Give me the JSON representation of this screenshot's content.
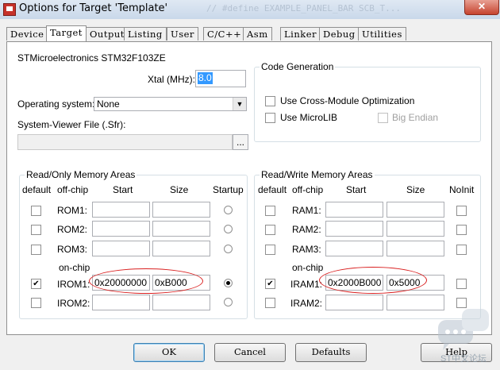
{
  "window": {
    "title": "Options for Target 'Template'",
    "close_label": "✕",
    "bg_text": "// #define EXAMPLE_PANEL_BAR  SCB_T..."
  },
  "tabs": [
    "Device",
    "Target",
    "Output",
    "Listing",
    "User",
    "C/C++",
    "Asm",
    "Linker",
    "Debug",
    "Utilities"
  ],
  "active_tab": "Target",
  "device": "STMicroelectronics STM32F103ZE",
  "xtal": {
    "label": "Xtal (MHz):",
    "value": "8.0"
  },
  "os": {
    "label": "Operating system:",
    "value": "None"
  },
  "svf": {
    "label": "System-Viewer File (.Sfr):",
    "value": "",
    "browse": "..."
  },
  "codegen": {
    "title": "Code Generation",
    "cross_module": "Use Cross-Module Optimization",
    "microlib": "Use MicroLIB",
    "big_endian": "Big Endian"
  },
  "rom": {
    "title": "Read/Only Memory Areas",
    "headers": {
      "default": "default",
      "offchip": "off-chip",
      "start": "Start",
      "size": "Size",
      "extra": "Startup"
    },
    "onchip_label": "on-chip",
    "rows": [
      {
        "name": "ROM1:",
        "start": "",
        "size": "",
        "default": false,
        "radio": false
      },
      {
        "name": "ROM2:",
        "start": "",
        "size": "",
        "default": false,
        "radio": false
      },
      {
        "name": "ROM3:",
        "start": "",
        "size": "",
        "default": false,
        "radio": false
      },
      {
        "name": "IROM1:",
        "start": "0x20000000",
        "size": "0xB000",
        "default": true,
        "radio": true
      },
      {
        "name": "IROM2:",
        "start": "",
        "size": "",
        "default": false,
        "radio": false
      }
    ]
  },
  "ram": {
    "title": "Read/Write Memory Areas",
    "headers": {
      "default": "default",
      "offchip": "off-chip",
      "start": "Start",
      "size": "Size",
      "extra": "NoInit"
    },
    "onchip_label": "on-chip",
    "rows": [
      {
        "name": "RAM1:",
        "start": "",
        "size": "",
        "default": false
      },
      {
        "name": "RAM2:",
        "start": "",
        "size": "",
        "default": false
      },
      {
        "name": "RAM3:",
        "start": "",
        "size": "",
        "default": false
      },
      {
        "name": "IRAM1:",
        "start": "0x2000B000",
        "size": "0x5000",
        "default": true
      },
      {
        "name": "IRAM2:",
        "start": "",
        "size": "",
        "default": false
      }
    ]
  },
  "buttons": {
    "ok": "OK",
    "cancel": "Cancel",
    "defaults": "Defaults",
    "help": "Help"
  },
  "watermark": "ST中文论坛",
  "colors": {
    "annotation": "#d92020",
    "selection": "#3399ff"
  }
}
